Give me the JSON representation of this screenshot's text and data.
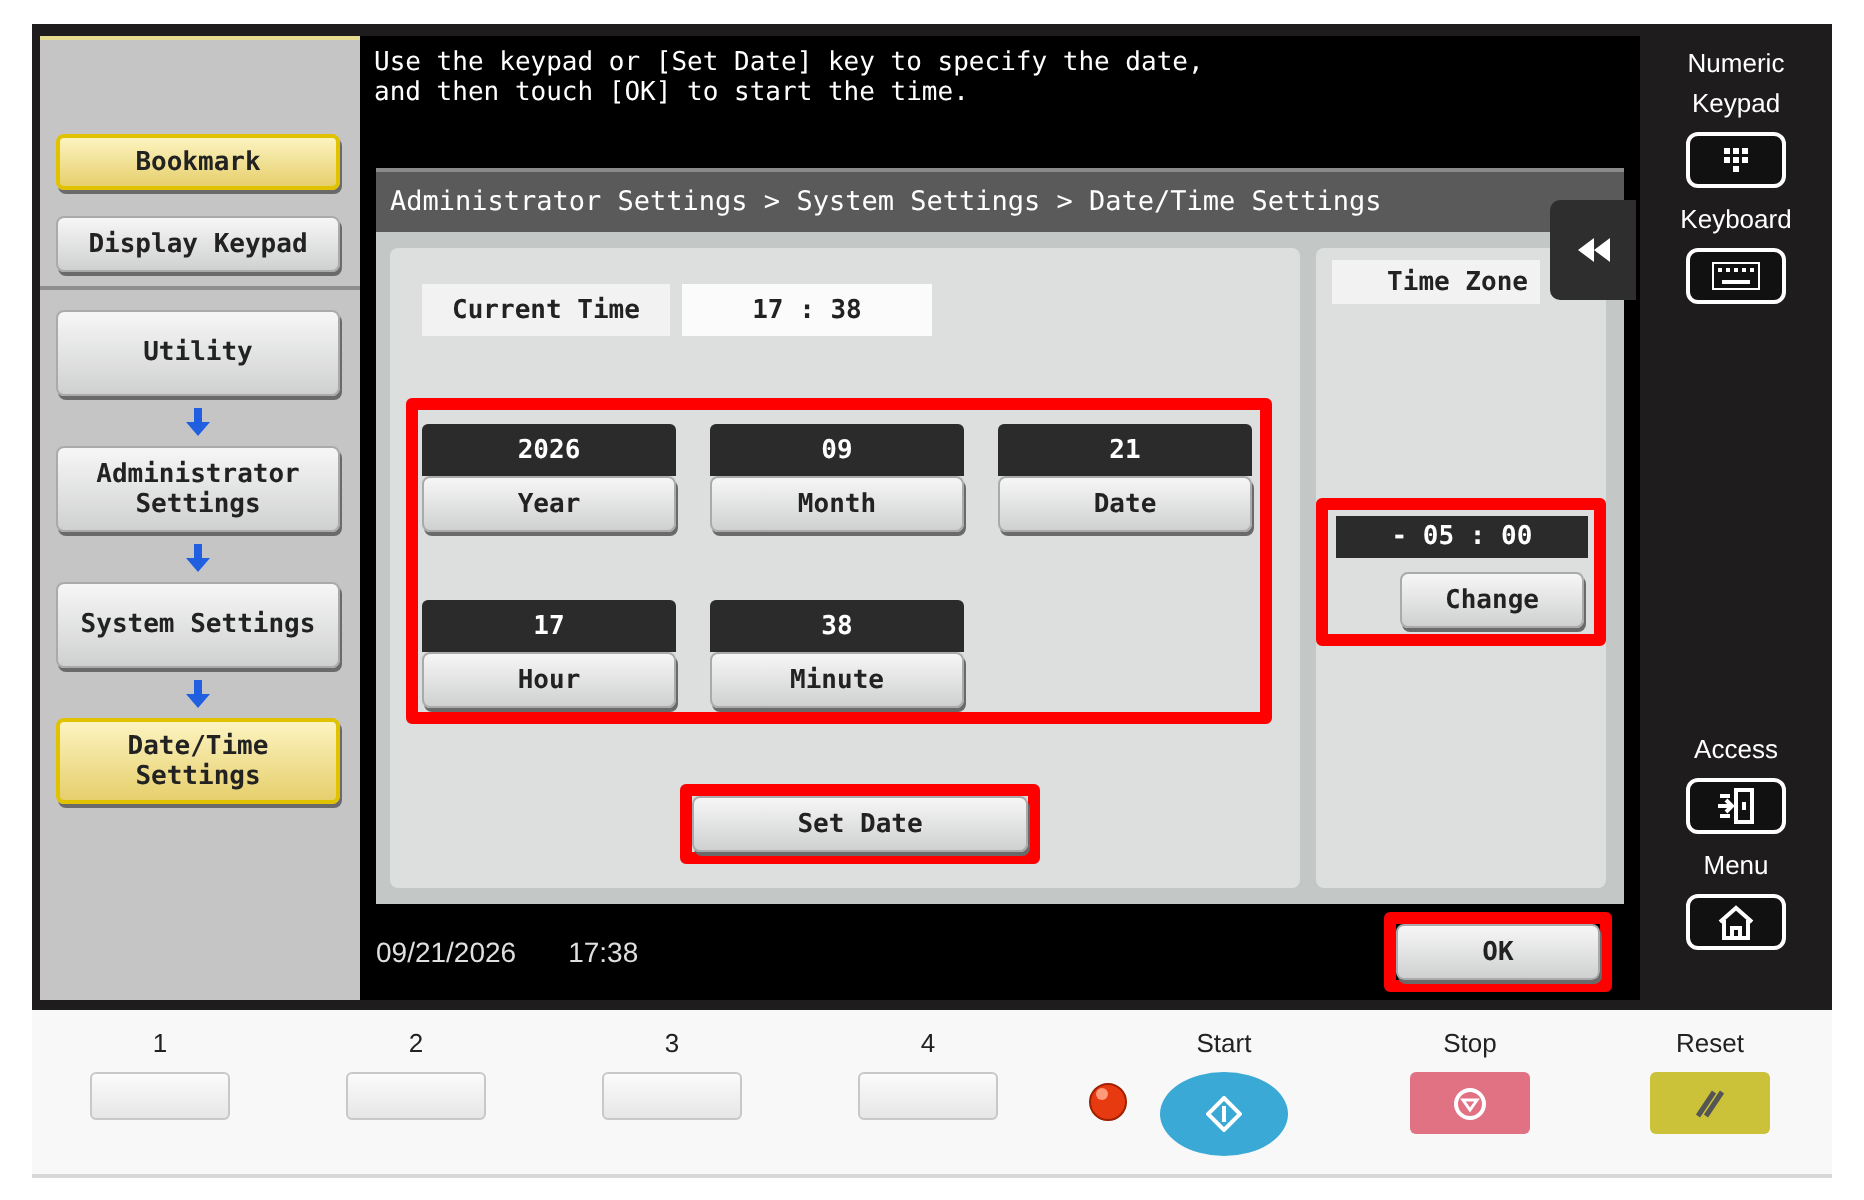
{
  "message": "Use the keypad or [Set Date] key to specify the date,\nand then touch [OK] to start the time.",
  "sidebar": {
    "top_buttons": [
      {
        "label": "Bookmark",
        "selected": true
      },
      {
        "label": "Display Keypad",
        "selected": false
      }
    ],
    "path": [
      {
        "label": "Utility",
        "selected": false
      },
      {
        "label": "Administrator Settings",
        "selected": false
      },
      {
        "label": "System Settings",
        "selected": false
      },
      {
        "label": "Date/Time Settings",
        "selected": true
      }
    ]
  },
  "breadcrumb": "Administrator Settings > System Settings > Date/Time Settings",
  "current_time": {
    "label": "Current Time",
    "value": "17 : 38"
  },
  "date_fields": {
    "highlighted": true,
    "items": [
      {
        "value": "2026",
        "label": "Year"
      },
      {
        "value": "09",
        "label": "Month"
      },
      {
        "value": "21",
        "label": "Date"
      },
      {
        "value": "17",
        "label": "Hour"
      },
      {
        "value": "38",
        "label": "Minute"
      }
    ]
  },
  "set_date": {
    "label": "Set Date",
    "highlighted": true
  },
  "time_zone": {
    "label": "Time Zone",
    "value": "- 05 : 00",
    "button": "Change",
    "highlighted": true
  },
  "status_bar": {
    "date": "09/21/2026",
    "time": "17:38"
  },
  "ok_button": {
    "label": "OK",
    "highlighted": true
  },
  "right_panel": {
    "top": [
      {
        "label": "Numeric Keypad",
        "kind": "keypad"
      },
      {
        "label": "Keyboard",
        "kind": "keyboard"
      }
    ],
    "bottom": [
      {
        "label": "Access",
        "kind": "access"
      },
      {
        "label": "Menu",
        "kind": "home"
      }
    ]
  },
  "hard_keys": [
    {
      "label": "1",
      "kind": "memory"
    },
    {
      "label": "2",
      "kind": "memory"
    },
    {
      "label": "3",
      "kind": "memory"
    },
    {
      "label": "4",
      "kind": "memory"
    },
    {
      "label": "Start",
      "kind": "start"
    },
    {
      "label": "Stop",
      "kind": "stop"
    },
    {
      "label": "Reset",
      "kind": "reset"
    }
  ]
}
